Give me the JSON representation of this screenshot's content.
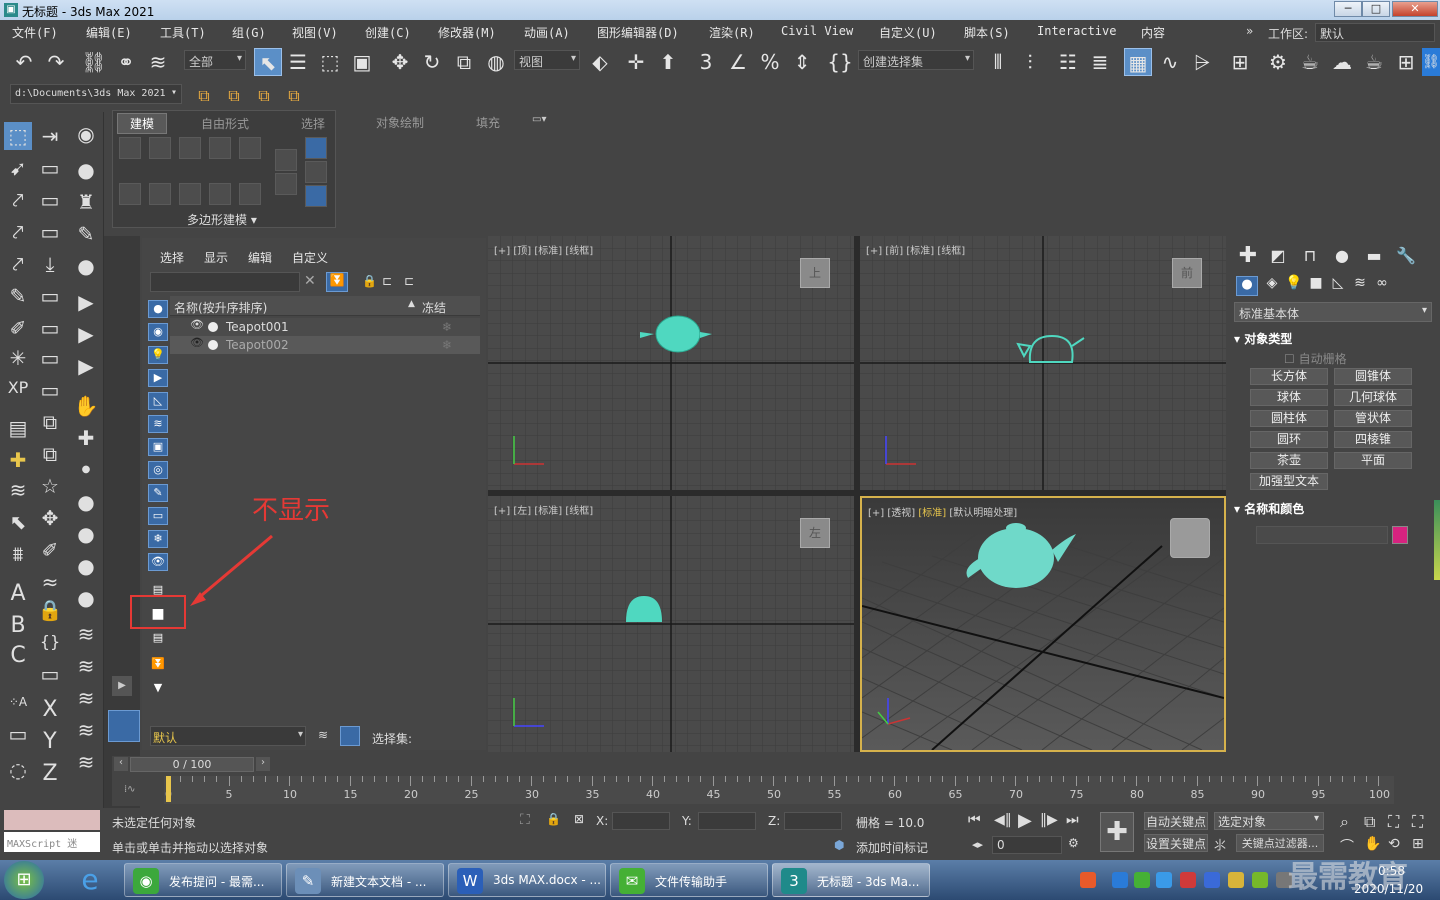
{
  "window": {
    "title": "无标题 - 3ds Max 2021",
    "min": "─",
    "max": "□",
    "close": "✕"
  },
  "menus": [
    "文件(F)",
    "编辑(E)",
    "工具(T)",
    "组(G)",
    "视图(V)",
    "创建(C)",
    "修改器(M)",
    "动画(A)",
    "图形编辑器(D)",
    "渲染(R)",
    "Civil View",
    "自定义(U)",
    "脚本(S)",
    "Interactive",
    "内容"
  ],
  "workspace": {
    "label": "工作区:",
    "value": "默认",
    "chevrons": "»"
  },
  "toolbar": {
    "filter": "全部",
    "refcoord": "视图",
    "selset": "创建选择集"
  },
  "projectPath": "d:\\Documents\\3ds Max 2021",
  "ribbon": {
    "tabs": [
      "建模",
      "自由形式",
      "选择",
      "对象绘制",
      "填充"
    ],
    "group": "多边形建模"
  },
  "scene": {
    "tabs": [
      "选择",
      "显示",
      "编辑",
      "自定义"
    ],
    "colName": "名称(按升序排序)",
    "colFrozen": "冻结",
    "sortArrow": "▲",
    "rows": [
      {
        "name": "Teapot001"
      },
      {
        "name": "Teapot002"
      }
    ],
    "layer": "默认",
    "selsetLabel": "选择集:"
  },
  "viewports": {
    "top": {
      "label": "[+] [顶] [标准] [线框]",
      "cube": "上"
    },
    "front": {
      "label": "[+] [前] [标准] [线框]",
      "cube": "前"
    },
    "left": {
      "label": "[+] [左] [标准] [线框]",
      "cube": "左"
    },
    "persp": {
      "p1": "[+] [透视] ",
      "p2": "[标准]",
      "p3": " [默认明暗处理]"
    }
  },
  "annotation": "不显示",
  "cmd": {
    "dropdown": "标准基本体",
    "objType": "对象类型",
    "autogrid": "自动栅格",
    "buttons": [
      "长方体",
      "圆锥体",
      "球体",
      "几何球体",
      "圆柱体",
      "管状体",
      "圆环",
      "四棱锥",
      "茶壶",
      "平面",
      "加强型文本"
    ],
    "nameColor": "名称和颜色",
    "swatch": "#d6237f"
  },
  "timeline": {
    "frame": "0 / 100",
    "ticks": [
      "0",
      "5",
      "10",
      "15",
      "20",
      "25",
      "30",
      "35",
      "40",
      "45",
      "50",
      "55",
      "60",
      "65",
      "70",
      "75",
      "80",
      "85",
      "90",
      "95",
      "100"
    ]
  },
  "status": {
    "maxscript": "MAXScript 迷",
    "line1": "未选定任何对象",
    "line2": "单击或单击并拖动以选择对象",
    "x": "X:",
    "y": "Y:",
    "z": "Z:",
    "grid": "栅格 = 10.0",
    "addTag": "添加时间标记",
    "autoKey": "自动关键点",
    "selObj": "选定对象",
    "setKey": "设置关键点",
    "keyFilter": "关键点过滤器...",
    "frameVal": "0"
  },
  "taskbar": {
    "tasks": [
      "发布提问 - 最需...",
      "新建文本文档 - ...",
      "3ds MAX.docx - ...",
      "文件传输助手",
      "无标题 - 3ds Ma..."
    ],
    "time": "0:58",
    "date": "2020/11/20",
    "watermark": "最需教育"
  }
}
